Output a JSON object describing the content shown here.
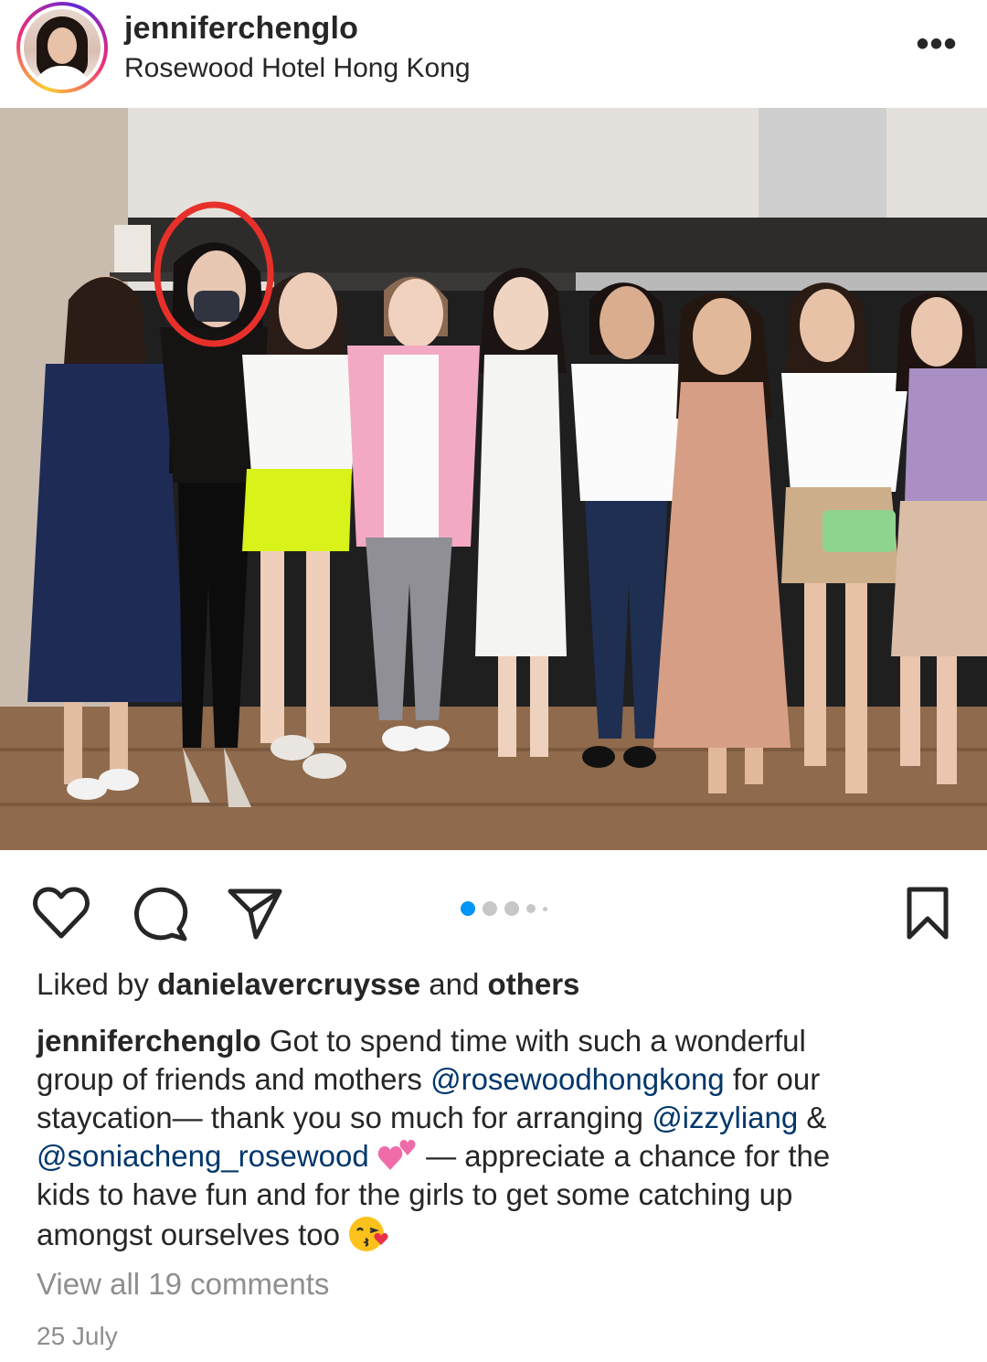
{
  "post": {
    "username": "jenniferchenglo",
    "location": "Rosewood Hotel Hong Kong",
    "more_label": "•••",
    "carousel": {
      "count": 5,
      "active_index": 0
    },
    "liked_by": {
      "prefix": "Liked by ",
      "user": "danielavercruysse",
      "middle": " and ",
      "others": "others"
    },
    "caption": {
      "author": "jenniferchenglo",
      "line1": " Got to spend time with such a wonderful",
      "line2_text": "group of friends and mothers ",
      "mention1": "@rosewoodhongkong",
      "line2_tail": " for our",
      "line3_text": "staycation— thank you so much for arranging ",
      "mention2": "@izzyliang",
      "line3_tail": " &",
      "mention3": "@soniacheng_rosewood",
      "line4_tail": "  — appreciate a chance for the",
      "line5": "kids to have fun and for the girls to get some catching up",
      "line6": "amongst ourselves too "
    },
    "view_comments": "View all 19 comments",
    "date": "25 July"
  },
  "icons": {
    "like": "heart-icon",
    "comment": "comment-icon",
    "share": "send-icon",
    "save": "bookmark-icon",
    "emoji1": "two-hearts-emoji",
    "emoji2": "kissing-face-emoji"
  },
  "colors": {
    "text": "#262626",
    "mention": "#00376b",
    "muted": "#8e8e8e",
    "active_dot": "#0095f6",
    "highlight_circle": "#e8302a"
  }
}
